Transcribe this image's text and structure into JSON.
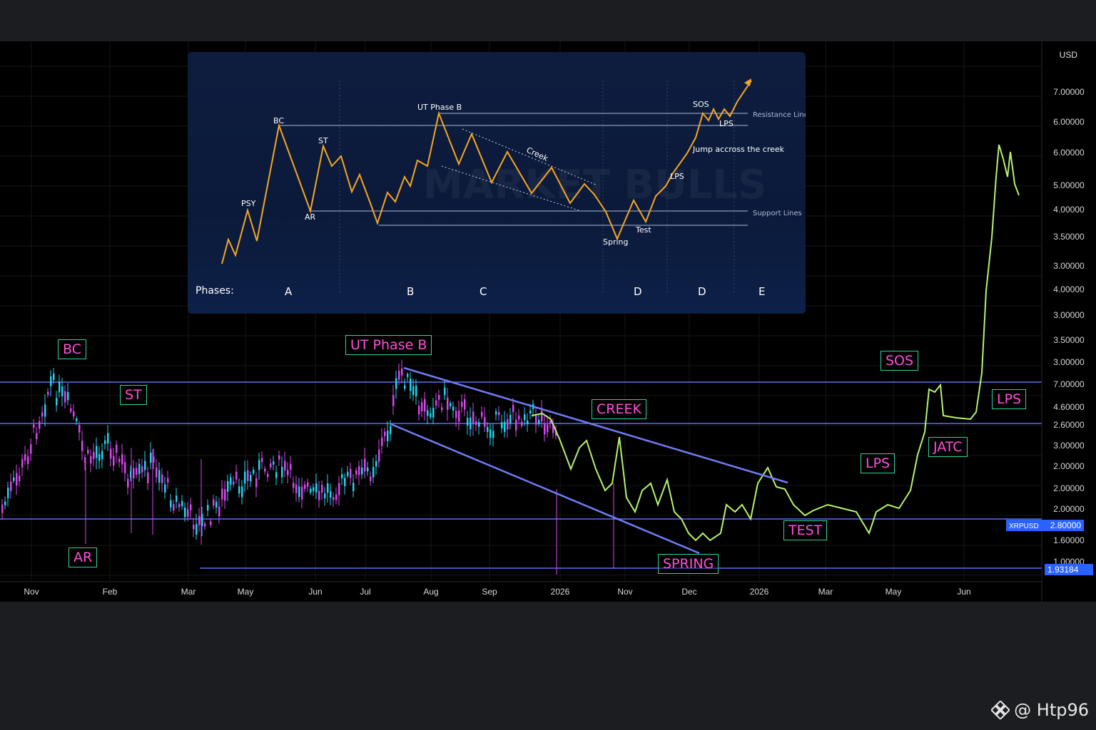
{
  "chart_data": {
    "type": "line",
    "currency_label": "USD",
    "x_ticks": [
      "Nov",
      "Feb",
      "Mar",
      "May",
      "Jun",
      "Jul",
      "Aug",
      "Sep",
      "2026",
      "Nov",
      "Dec",
      "2026",
      "Mar",
      "May",
      "Jun"
    ],
    "y_ticks": [
      "7.00000",
      "6.00000",
      "6.00000",
      "5.00000",
      "4.00000",
      "3.50000",
      "3.00000",
      "4.00000",
      "3.00000",
      "3.50000",
      "3.00000",
      "7.00000",
      "4.60000",
      "2.60000",
      "3.00000",
      "2.00000",
      "2.00000",
      "2.00000",
      "1.60000",
      "1.00000"
    ],
    "price_tags": [
      {
        "ticker": "XRPUSD",
        "value": "2.80000",
        "color": "#2962ff"
      },
      {
        "value": "1.93184",
        "color": "#2962ff"
      }
    ],
    "wyckoff_labels": [
      "BC",
      "ST",
      "AR",
      "UT Phase B",
      "CREEK",
      "SPRING",
      "TEST",
      "LPS",
      "SOS",
      "JATC",
      "LPS"
    ],
    "inset": {
      "point_labels": [
        "PSY",
        "BC",
        "AR",
        "ST",
        "UT Phase B",
        "Creek",
        "Spring",
        "Test",
        "LPS",
        "Jump accross the creek",
        "SOS",
        "LPS"
      ],
      "line_labels": [
        "Resistance Lines",
        "Support Lines"
      ],
      "phases_title": "Phases:",
      "phases": [
        "A",
        "B",
        "C",
        "D",
        "D",
        "E"
      ],
      "watermark": "MARKET BULLS"
    },
    "horizontal_levels": [
      "7.00000",
      "2.60000",
      "2.80000",
      "1.93184"
    ],
    "series": [
      {
        "type": "candlestick"
      },
      {
        "type": "projection-line",
        "color": "#b6f36a"
      }
    ]
  },
  "watermark": {
    "handle": "@ Htp96"
  },
  "colors": {
    "level_line": "#5b6ef5",
    "label_border": "#2fd3a2",
    "label_text": "#ff4fd8",
    "bull": "#22d3ee",
    "bear": "#d946ef",
    "projection": "#b6f36a",
    "inset_path": "#f5a623"
  }
}
